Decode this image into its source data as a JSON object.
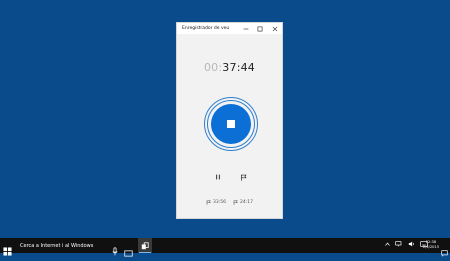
{
  "window": {
    "title": "Enregistrador de veu"
  },
  "timer": {
    "faded": "00:",
    "active": "37:44"
  },
  "markers": [
    {
      "time": "33:56"
    },
    {
      "time": "24:17"
    }
  ],
  "taskbar": {
    "search_text": "Cerca a Internet i al Windows",
    "clock_time": "22:38",
    "clock_date": "2/4/2015"
  },
  "colors": {
    "desktop": "#0a4c8b",
    "accent": "#0b6fd6",
    "taskbar": "#101010"
  }
}
